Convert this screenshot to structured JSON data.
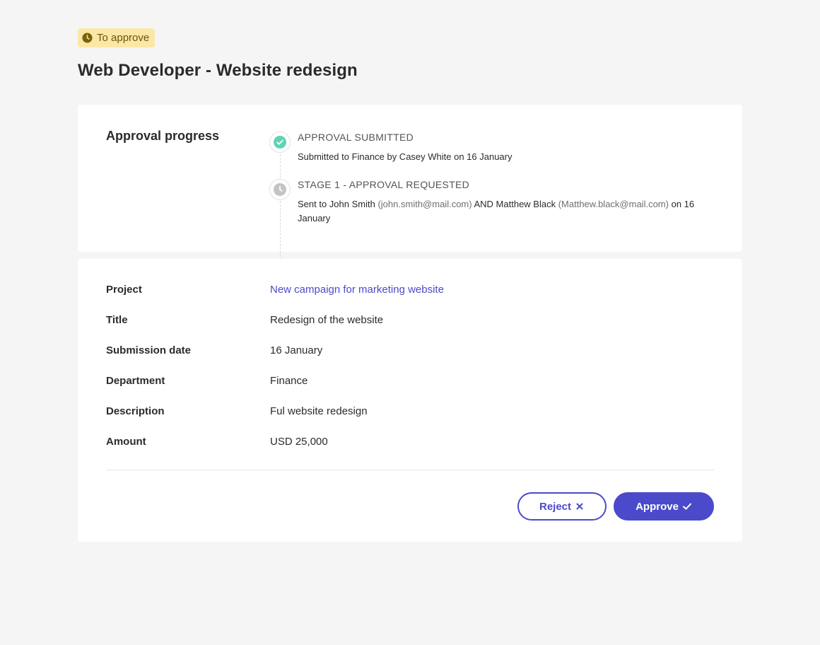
{
  "status": {
    "label": "To approve",
    "icon": "clock-icon",
    "color": "#fbe8a6"
  },
  "page": {
    "title": "Web Developer - Website redesign"
  },
  "progress": {
    "heading": "Approval progress",
    "steps": [
      {
        "title": "APPROVAL SUBMITTED",
        "icon": "check-circle-icon",
        "status": "complete",
        "body": "Submitted to Finance by Casey White on 16 January"
      },
      {
        "title": "STAGE 1 - APPROVAL REQUESTED",
        "icon": "clock-icon",
        "status": "pending",
        "body_prefix": "Sent to John Smith",
        "email_1": "(john.smith@mail.com)",
        "body_mid": "AND Matthew Black",
        "email_2": "(Matthew.black@mail.com)",
        "body_suffix": "on 16 January"
      }
    ]
  },
  "details": {
    "rows": [
      {
        "label": "Project",
        "value": "New campaign for marketing website",
        "is_link": true
      },
      {
        "label": "Title",
        "value": "Redesign of the website"
      },
      {
        "label": "Submission date",
        "value": "16 January"
      },
      {
        "label": "Department",
        "value": "Finance"
      },
      {
        "label": "Description",
        "value": "Ful website redesign"
      },
      {
        "label": "Amount",
        "value": "USD 25,000"
      }
    ]
  },
  "actions": {
    "reject_label": "Reject",
    "approve_label": "Approve"
  },
  "colors": {
    "accent": "#4a4acb",
    "success": "#5fd3b5",
    "pending": "#c4c4c4",
    "pill_bg": "#fbe8a6",
    "pill_text": "#6b5608"
  }
}
